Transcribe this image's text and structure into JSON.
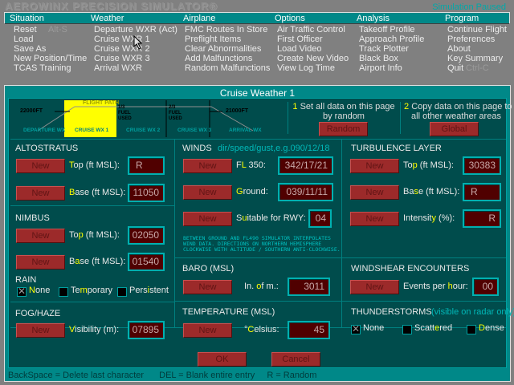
{
  "app": {
    "title": "AEROWINX PRECISION SIMULATOR®",
    "status": "Simulation Paused"
  },
  "menu": [
    {
      "label": "Situation",
      "items": [
        {
          "label": "Reset",
          "shortcut": "Alt-S"
        },
        {
          "label": "Load"
        },
        {
          "label": "Save As"
        },
        {
          "label": "New Position/Time"
        },
        {
          "label": "TCAS Training"
        }
      ]
    },
    {
      "label": "Weather",
      "items": [
        {
          "label": "Departure WXR (Act)"
        },
        {
          "label": "Cruise WXR 1"
        },
        {
          "label": "Cruise WXR 2"
        },
        {
          "label": "Cruise WXR 3"
        },
        {
          "label": "Arrival WXR"
        }
      ]
    },
    {
      "label": "Airplane",
      "items": [
        {
          "label": "FMC Routes In Store"
        },
        {
          "label": "Preflight Items"
        },
        {
          "label": "Clear Abnormalities"
        },
        {
          "label": "Add Malfunctions"
        },
        {
          "label": "Random Malfunctions"
        }
      ]
    },
    {
      "label": "Options",
      "items": [
        {
          "label": "Air Traffic Control"
        },
        {
          "label": "First Officer"
        },
        {
          "label": "Load Video"
        },
        {
          "label": "Create New Video"
        },
        {
          "label": "View Log Time"
        }
      ]
    },
    {
      "label": "Analysis",
      "items": [
        {
          "label": "Takeoff Profile"
        },
        {
          "label": "Approach Profile"
        },
        {
          "label": "Track Plotter"
        },
        {
          "label": "Black Box"
        },
        {
          "label": "Airport Info"
        }
      ]
    },
    {
      "label": "Program",
      "items": [
        {
          "label": "Continue Flight"
        },
        {
          "label": "Preferences"
        },
        {
          "label": "About"
        },
        {
          "label": "Key Summary"
        },
        {
          "label": "Quit",
          "shortcut": "Ctrl-C"
        }
      ]
    }
  ],
  "dialog": {
    "title": "Cruise Weather 1",
    "diagram": {
      "flight_path": "FLIGHT PATH",
      "alt_left": "22000FT",
      "alt_right": "21000FT",
      "fuel1": [
        "1/3",
        "FUEL",
        "USED"
      ],
      "fuel2": [
        "2/3",
        "FUEL",
        "USED"
      ],
      "zones": [
        "DEPARTURE WX",
        "CRUISE WX 1",
        "CRUISE WX 2",
        "CRUISE WX 3",
        "ARRIVAL WX"
      ]
    },
    "random": {
      "num": "1",
      "text1": "Set all data on this page",
      "text2": "by random",
      "button": "Random"
    },
    "global": {
      "num": "2",
      "text1": "Copy data on this page to",
      "text2": "all other weather areas",
      "button": "Global"
    },
    "new_label": "New",
    "altostratus": {
      "title": "ALTOSTRATUS",
      "top": {
        "key": "T",
        "post": "op (ft MSL):",
        "value": "R"
      },
      "base": {
        "key": "B",
        "post": "ase (ft MSL):",
        "value": "11050"
      }
    },
    "nimbus": {
      "title": "NIMBUS",
      "top": {
        "pre": "To",
        "key": "p",
        "post": " (ft MSL):",
        "value": "02050"
      },
      "base": {
        "pre": "B",
        "key": "a",
        "post": "se (ft MSL):",
        "value": "01540"
      }
    },
    "rain": {
      "title": "RAIN",
      "options": [
        {
          "pre": "",
          "key": "N",
          "post": "one",
          "checked": true
        },
        {
          "pre": "Te",
          "key": "m",
          "post": "porary",
          "checked": false
        },
        {
          "pre": "Pers",
          "key": "i",
          "post": "stent",
          "checked": false
        }
      ]
    },
    "fog": {
      "title": "FOG/HAZE",
      "visibility": {
        "key": "V",
        "post": "isibility (m):",
        "value": "07895"
      }
    },
    "winds": {
      "title": "WINDS",
      "hint": "dir/speed/gust,e.g.090/12/18",
      "fl350": {
        "pre": "F",
        "key": "L",
        "post": " 350:",
        "value": "342/17/21"
      },
      "ground": {
        "key": "G",
        "post": "round:",
        "value": "039/11/11"
      },
      "rwy": {
        "pre": "S",
        "key": "u",
        "post": "itable for RWY:",
        "value": "04"
      },
      "note": [
        "BETWEEN GROUND AND FL490 SIMULATOR INTERPOLATES",
        "WIND DATA. DIRECTIONS ON NORTHERN HEMISPHERE",
        "CLOCKWISE WITH ALTITUDE / SOUTHERN ANTI-CLOCKWISE."
      ]
    },
    "baro": {
      "title": "BARO (MSL)",
      "field": {
        "pre": "In. ",
        "key": "o",
        "post": "f m.:",
        "value": "3011"
      }
    },
    "temperature": {
      "title": "TEMPERATURE (MSL)",
      "field": {
        "pre": "°",
        "key": "C",
        "post": "elsius:",
        "value": "45"
      }
    },
    "turbulence": {
      "title": "TURBULENCE LAYER",
      "top": {
        "pre": "To",
        "key": "p",
        "post": " (ft MSL):",
        "value": "30383"
      },
      "base": {
        "pre": "Ba",
        "key": "s",
        "post": "e (ft MSL):",
        "value": "R"
      },
      "intensity": {
        "pre": "Intensit",
        "key": "y",
        "post": " (%):",
        "value": "R"
      }
    },
    "windshear": {
      "title": "WINDSHEAR ENCOUNTERS",
      "field": {
        "pre": "Events per ",
        "key": "h",
        "post": "our:",
        "value": "00"
      }
    },
    "thunderstorms": {
      "title": "THUNDERSTORMS",
      "hint": "(visible on radar only)",
      "options": [
        {
          "pre": "None",
          "key": "",
          "post": "",
          "checked": true
        },
        {
          "pre": "Scatt",
          "key": "e",
          "post": "red",
          "checked": false
        },
        {
          "pre": "",
          "key": "D",
          "post": "ense",
          "checked": false
        }
      ]
    },
    "ok": "OK",
    "cancel": "Cancel",
    "status": [
      "BackSpace = Delete last character",
      "DEL = Blank entire entry",
      "R = Random"
    ]
  }
}
